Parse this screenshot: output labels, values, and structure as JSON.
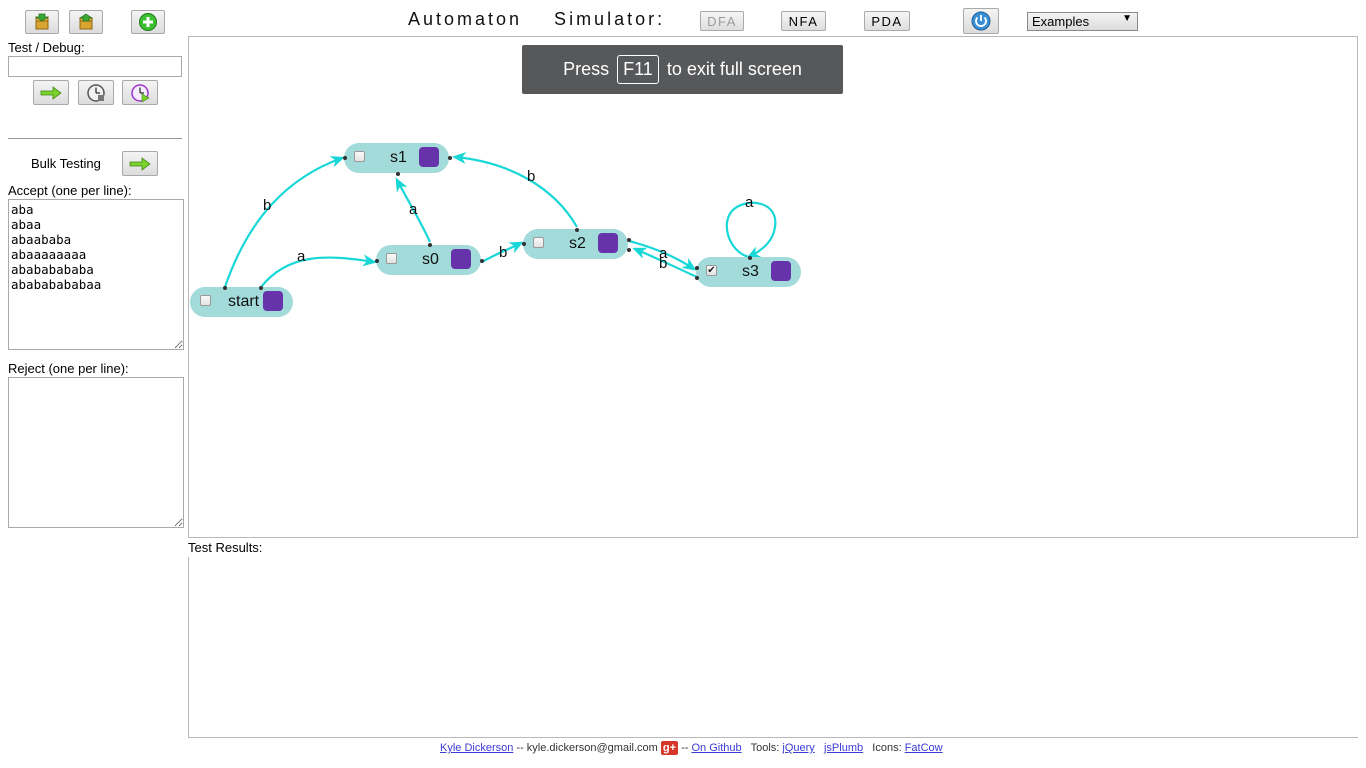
{
  "header": {
    "title": "Automaton    Simulator:",
    "modes": [
      "DFA",
      "NFA",
      "PDA"
    ],
    "examples_select": "Examples"
  },
  "toolbar": {
    "load_icon": "load-box-icon",
    "save_icon": "save-box-icon",
    "add_state_icon": "plus-icon"
  },
  "debug": {
    "label": "Test / Debug:",
    "input_value": "",
    "run_icon": "arrow-right-icon",
    "step_icon": "clock-icon",
    "step_through_icon": "clock-play-icon"
  },
  "bulk": {
    "label": "Bulk Testing",
    "run_icon": "arrow-right-icon",
    "accept_label": "Accept (one per line):",
    "accept_text": "aba\nabaa\nabaababa\nabaaaaaaaa\nabababababa\nabababababaa",
    "reject_label": "Reject (one per line):",
    "reject_text": ""
  },
  "fullscreen_notice": {
    "before": "Press",
    "key": "F11",
    "after": "to exit full screen"
  },
  "automaton": {
    "states": [
      {
        "name": "start",
        "accept": false
      },
      {
        "name": "s0",
        "accept": false
      },
      {
        "name": "s1",
        "accept": false
      },
      {
        "name": "s2",
        "accept": false
      },
      {
        "name": "s3",
        "accept": true
      }
    ],
    "transitions": [
      {
        "from": "start",
        "to": "s1",
        "symbol": "b"
      },
      {
        "from": "start",
        "to": "s0",
        "symbol": "a"
      },
      {
        "from": "s0",
        "to": "s1",
        "symbol": "a"
      },
      {
        "from": "s0",
        "to": "s2",
        "symbol": "b"
      },
      {
        "from": "s2",
        "to": "s1",
        "symbol": "b"
      },
      {
        "from": "s2",
        "to": "s3",
        "symbol": "a"
      },
      {
        "from": "s3",
        "to": "s2",
        "symbol": "b"
      },
      {
        "from": "s3",
        "to": "s3",
        "symbol": "a"
      }
    ]
  },
  "results": {
    "label": "Test Results:"
  },
  "footer": {
    "author": "Kyle Dickerson",
    "email": "-- kyle.dickerson@gmail.com",
    "gplus": "g+",
    "sep": "--",
    "github": "On Github",
    "tools_label": "Tools:",
    "tool1": "jQuery",
    "tool2": "jsPlumb",
    "icons_label": "Icons:",
    "icons_link": "FatCow"
  },
  "colors": {
    "state_fill": "#a3dbdb",
    "state_box": "#6633aa",
    "edge": "#19d7d7"
  }
}
